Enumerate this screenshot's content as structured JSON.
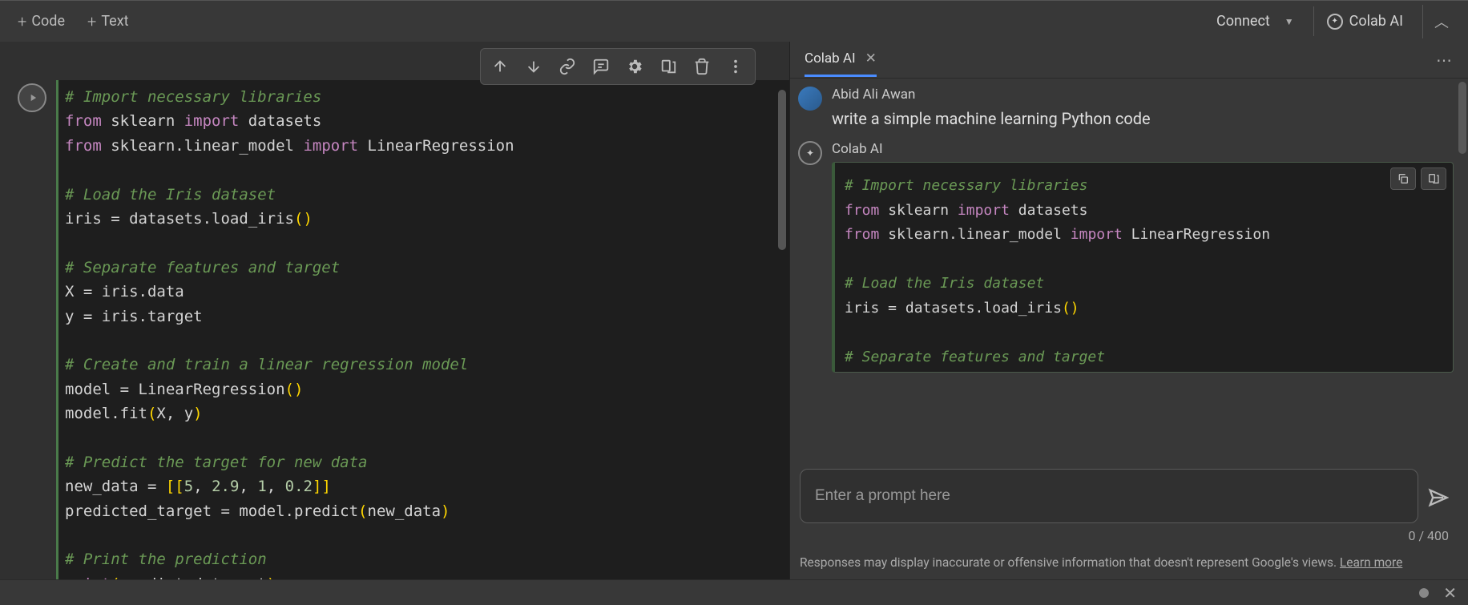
{
  "toolbar": {
    "code_label": "Code",
    "text_label": "Text",
    "connect_label": "Connect",
    "colab_ai_label": "Colab AI"
  },
  "cell": {
    "code_lines": [
      {
        "t": "comment",
        "s": "# Import necessary libraries"
      },
      {
        "t": "code",
        "s": "from sklearn import datasets"
      },
      {
        "t": "code",
        "s": "from sklearn.linear_model import LinearRegression"
      },
      {
        "t": "blank",
        "s": ""
      },
      {
        "t": "comment",
        "s": "# Load the Iris dataset"
      },
      {
        "t": "code",
        "s": "iris = datasets.load_iris()"
      },
      {
        "t": "blank",
        "s": ""
      },
      {
        "t": "comment",
        "s": "# Separate features and target"
      },
      {
        "t": "code",
        "s": "X = iris.data"
      },
      {
        "t": "code",
        "s": "y = iris.target"
      },
      {
        "t": "blank",
        "s": ""
      },
      {
        "t": "comment",
        "s": "# Create and train a linear regression model"
      },
      {
        "t": "code",
        "s": "model = LinearRegression()"
      },
      {
        "t": "code",
        "s": "model.fit(X, y)"
      },
      {
        "t": "blank",
        "s": ""
      },
      {
        "t": "comment",
        "s": "# Predict the target for new data"
      },
      {
        "t": "code",
        "s": "new_data = [[5, 2.9, 1, 0.2]]"
      },
      {
        "t": "code",
        "s": "predicted_target = model.predict(new_data)"
      },
      {
        "t": "blank",
        "s": ""
      },
      {
        "t": "comment",
        "s": "# Print the prediction"
      },
      {
        "t": "code",
        "s": "print(predicted_target)"
      }
    ]
  },
  "ai_panel": {
    "tab_label": "Colab AI",
    "user_name": "Abid Ali Awan",
    "user_prompt": "write a simple machine learning Python code",
    "bot_name": "Colab AI",
    "bot_code_lines": [
      {
        "t": "comment",
        "s": "# Import necessary libraries"
      },
      {
        "t": "code",
        "s": "from sklearn import datasets"
      },
      {
        "t": "code",
        "s": "from sklearn.linear_model import LinearRegression"
      },
      {
        "t": "blank",
        "s": ""
      },
      {
        "t": "comment",
        "s": "# Load the Iris dataset"
      },
      {
        "t": "code",
        "s": "iris = datasets.load_iris()"
      },
      {
        "t": "blank",
        "s": ""
      },
      {
        "t": "comment",
        "s": "# Separate features and target"
      }
    ],
    "prompt_placeholder": "Enter a prompt here",
    "char_count": "0 / 400",
    "disclaimer_text": "Responses may display inaccurate or offensive information that doesn't represent Google's views. ",
    "learn_more": "Learn more"
  }
}
